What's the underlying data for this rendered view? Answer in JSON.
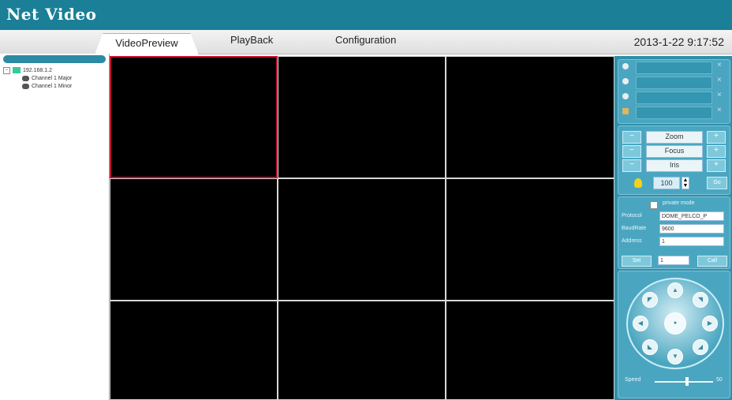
{
  "app": {
    "title": "Net Video"
  },
  "tabs": [
    {
      "label": "VideoPreview"
    },
    {
      "label": "PlayBack"
    },
    {
      "label": "Configuration"
    }
  ],
  "datetime": "2013-1-22  9:17:52",
  "tree": {
    "device": "192.168.1.2",
    "channels": [
      "Channel 1 Major",
      "Channel 1 Minor"
    ]
  },
  "ptz": {
    "zoom_label": "Zoom",
    "focus_label": "Focus",
    "iris_label": "Iris",
    "minus": "−",
    "plus": "+",
    "preset_value": "100",
    "goto_label": "Go",
    "private_mode_label": "private mode",
    "protocol_label": "Protocol",
    "protocol_value": "DOME_PELCO_P",
    "baudrate_label": "BaudRate",
    "baudrate_value": "9600",
    "address_label": "Address",
    "address_value": "1",
    "set_label": "Set",
    "preset_input": "1",
    "call_label": "Call",
    "speed_label": "Speed",
    "speed_value": "50",
    "speed_level": 0.55
  },
  "close_mark": "×"
}
